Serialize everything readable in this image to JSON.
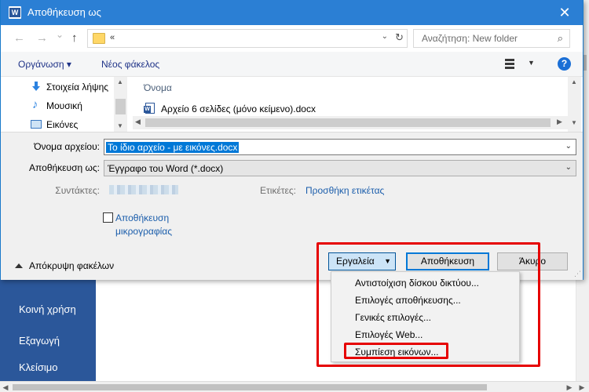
{
  "app": {
    "icon_letter": "W"
  },
  "backstage": {
    "items": [
      {
        "label": "Κοινή χρήση"
      },
      {
        "label": "Εξαγωγή"
      },
      {
        "label": "Κλείσιμο"
      }
    ]
  },
  "dialog": {
    "title": "Αποθήκευση ως",
    "close_glyph": "✕",
    "nav": {
      "back_glyph": "←",
      "forward_glyph": "→",
      "dropdown_glyph": "⌄",
      "up_glyph": "↑",
      "address": "«",
      "search_placeholder": "Αναζήτηση: New folder"
    },
    "toolbar": {
      "organize": "Οργάνωση ▾",
      "new_folder": "Νέος φάκελος",
      "help": "?"
    },
    "navpane": {
      "items": [
        {
          "label": "Στοιχεία λήψης",
          "icon": "download-arrow-icon"
        },
        {
          "label": "Μουσική",
          "icon": "music-note-icon"
        },
        {
          "label": "Εικόνες",
          "icon": "pictures-icon"
        }
      ]
    },
    "filelist": {
      "column_header": "Όνομα",
      "files": [
        {
          "name": "Αρχείο 6 σελίδες (μόνο κείμενο).docx"
        }
      ]
    },
    "form": {
      "filename_label": "Όνομα αρχείου:",
      "filename_value": "Το ίδιο αρχείο - με εικόνες.docx",
      "savetype_label": "Αποθήκευση ως:",
      "savetype_value": "Έγγραφο του Word (*.docx)",
      "authors_label": "Συντάκτες:",
      "tags_label": "Ετικέτες:",
      "tags_link": "Προσθήκη ετικέτας",
      "thumbnail_label_line1": "Αποθήκευση",
      "thumbnail_label_line2": "μικρογραφίας",
      "hide_folders": "Απόκρυψη φακέλων",
      "tools_button": "Εργαλεία",
      "save_button": "Αποθήκευση",
      "cancel_button": "Άκυρο"
    },
    "tools_menu": {
      "items": [
        {
          "label": "Αντιστοίχιση δίσκου δικτύου..."
        },
        {
          "label": "Επιλογές αποθήκευσης..."
        },
        {
          "label": "Γενικές επιλογές..."
        },
        {
          "label": "Επιλογές Web..."
        },
        {
          "label": "Συμπίεση εικόνων..."
        }
      ],
      "highlighted": "Συμπίεση εικόνων..."
    }
  },
  "colors": {
    "backstage_blue": "#2b579a",
    "titlebar_blue": "#2b7fd4",
    "annotation_red": "#e60000",
    "selection_blue": "#0078d7"
  }
}
